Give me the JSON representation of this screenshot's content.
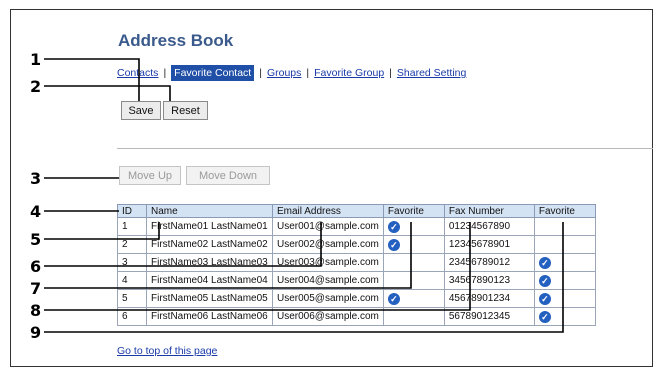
{
  "page": {
    "title": "Address Book"
  },
  "tabs": {
    "contacts": "Contacts",
    "favorite_contact": "Favorite Contact",
    "groups": "Groups",
    "favorite_group": "Favorite Group",
    "shared_setting": "Shared Setting",
    "separator": "|"
  },
  "buttons": {
    "save": "Save",
    "reset": "Reset",
    "move_up": "Move Up",
    "move_down": "Move Down"
  },
  "table": {
    "headers": [
      "ID",
      "Name",
      "Email Address",
      "Favorite",
      "Fax Number",
      "Favorite"
    ],
    "rows": [
      [
        "1",
        "FirstName01 LastName01",
        "User001@sample.com",
        "✓",
        "01234567890",
        ""
      ],
      [
        "2",
        "FirstName02 LastName02",
        "User002@sample.com",
        "✓",
        "12345678901",
        ""
      ],
      [
        "3",
        "FirstName03 LastName03",
        "User003@sample.com",
        "",
        "23456789012",
        "✓"
      ],
      [
        "4",
        "FirstName04 LastName04",
        "User004@sample.com",
        "",
        "34567890123",
        "✓"
      ],
      [
        "5",
        "FirstName05 LastName05",
        "User005@sample.com",
        "✓",
        "45678901234",
        "✓"
      ],
      [
        "6",
        "FirstName06 LastName06",
        "User006@sample.com",
        "",
        "56789012345",
        "✓"
      ]
    ]
  },
  "footer_link": "Go to top of this page",
  "callouts": [
    "1",
    "2",
    "3",
    "4",
    "5",
    "6",
    "7",
    "8",
    "9"
  ],
  "colors": {
    "accent": "#1f4fa6",
    "title": "#3a5a8c",
    "header_bg": "#d4e3f4",
    "link": "#1a3aa8"
  }
}
